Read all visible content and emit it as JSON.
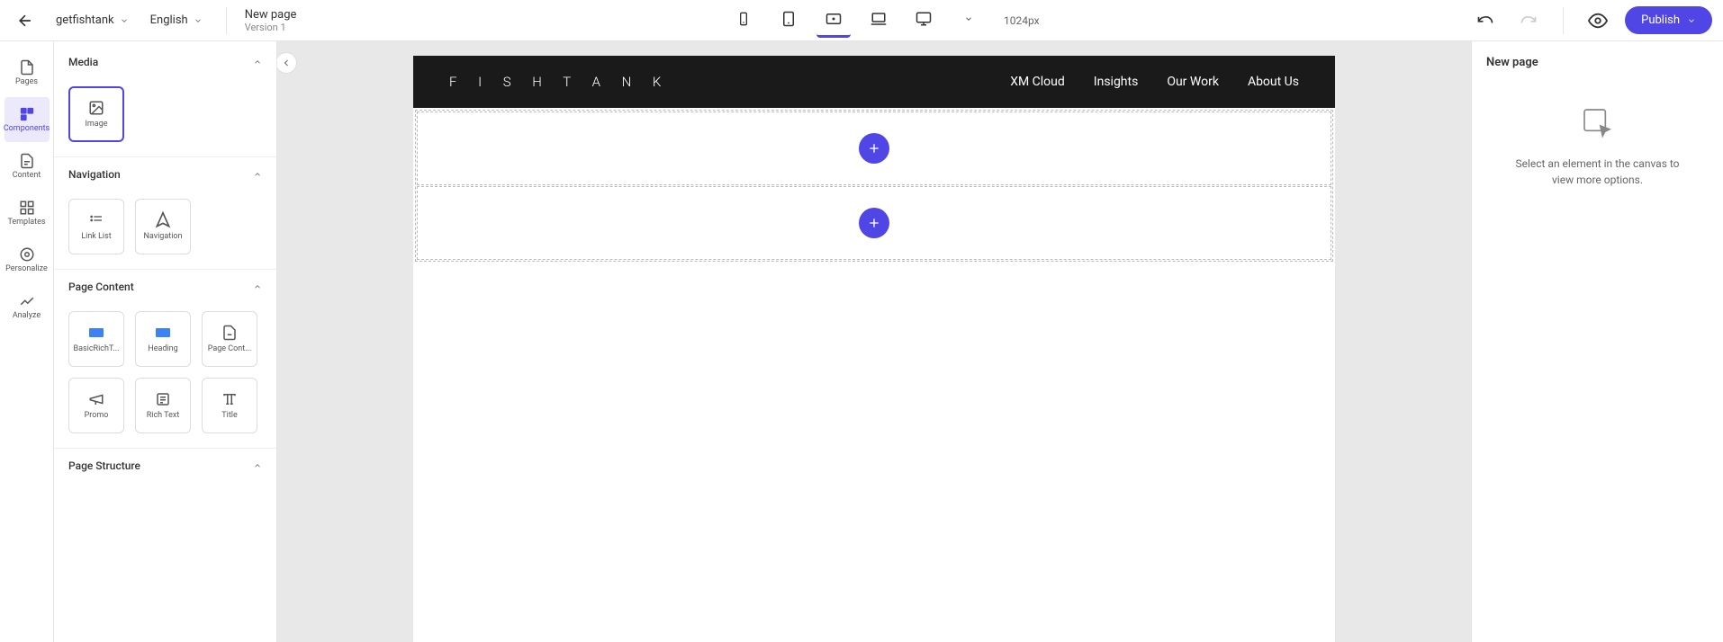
{
  "topbar": {
    "site": "getfishtank",
    "language": "English",
    "page_title": "New page",
    "version_label": "Version 1",
    "breakpoint": "1024px",
    "publish_label": "Publish"
  },
  "left_rail": [
    {
      "id": "pages",
      "label": "Pages"
    },
    {
      "id": "components",
      "label": "Components",
      "active": true
    },
    {
      "id": "content",
      "label": "Content"
    },
    {
      "id": "templates",
      "label": "Templates"
    },
    {
      "id": "personalize",
      "label": "Personalize"
    },
    {
      "id": "analyze",
      "label": "Analyze"
    }
  ],
  "component_sections": {
    "media": {
      "title": "Media",
      "items": [
        {
          "label": "Image",
          "selected": true
        }
      ]
    },
    "navigation": {
      "title": "Navigation",
      "items": [
        {
          "label": "Link List"
        },
        {
          "label": "Navigation"
        }
      ]
    },
    "page_content": {
      "title": "Page Content",
      "items": [
        {
          "label": "BasicRichT..."
        },
        {
          "label": "Heading"
        },
        {
          "label": "Page Cont..."
        },
        {
          "label": "Promo"
        },
        {
          "label": "Rich Text"
        },
        {
          "label": "Title"
        }
      ]
    },
    "page_structure": {
      "title": "Page Structure"
    }
  },
  "canvas": {
    "logo": "F I S H T A N K",
    "nav": [
      "XM Cloud",
      "Insights",
      "Our Work",
      "About Us"
    ]
  },
  "right_panel": {
    "title": "New page",
    "empty_text": "Select an element in the canvas to view more options."
  }
}
